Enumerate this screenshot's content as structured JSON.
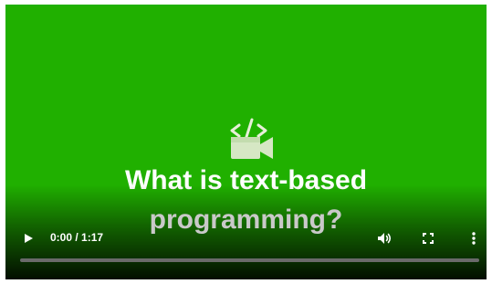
{
  "video": {
    "title_line_1": "What is text-based",
    "title_line_2": "programming?",
    "background_color": "#20b000",
    "logo_icon": "code-video-camera-icon"
  },
  "controls": {
    "play_icon": "play-icon",
    "time_display": "0:00 / 1:17",
    "volume_icon": "volume-icon",
    "fullscreen_icon": "fullscreen-icon",
    "menu_icon": "more-vertical-icon",
    "progress": 0
  }
}
